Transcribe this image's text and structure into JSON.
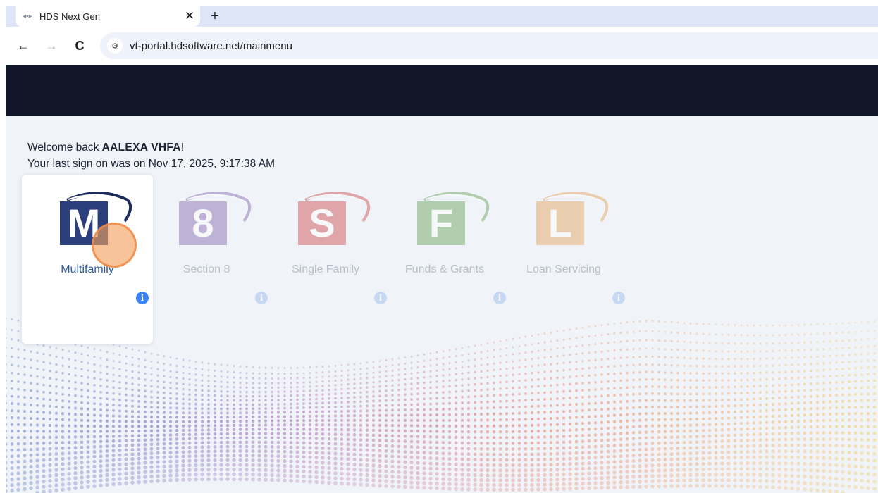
{
  "browser": {
    "tab_title": "HDS Next Gen",
    "close_glyph": "✕",
    "new_tab_glyph": "+",
    "back_glyph": "←",
    "forward_glyph": "→",
    "reload_glyph": "C",
    "site_info_glyph": "⚙",
    "url": "vt-portal.hdsoftware.net/mainmenu"
  },
  "welcome": {
    "prefix": "Welcome back ",
    "user": "AALEXA VHFA",
    "suffix": "!",
    "last_sign_on": "Your last sign on was on Nov 17, 2025, 9:17:38 AM"
  },
  "modules": [
    {
      "letter": "M",
      "label": "Multifamily",
      "color": "#2b3f7c",
      "arc": "#1c2c5c",
      "active": true
    },
    {
      "letter": "8",
      "label": "Section 8",
      "color": "#7a5aa8",
      "arc": "#7a5aa8",
      "active": false
    },
    {
      "letter": "S",
      "label": "Single Family",
      "color": "#cc3b3b",
      "arc": "#cc3b3b",
      "active": false
    },
    {
      "letter": "F",
      "label": "Funds & Grants",
      "color": "#5a9a4a",
      "arc": "#5a9a4a",
      "active": false
    },
    {
      "letter": "L",
      "label": "Loan Servicing",
      "color": "#e09a4a",
      "arc": "#e09a4a",
      "active": false
    }
  ],
  "info_glyph": "i"
}
